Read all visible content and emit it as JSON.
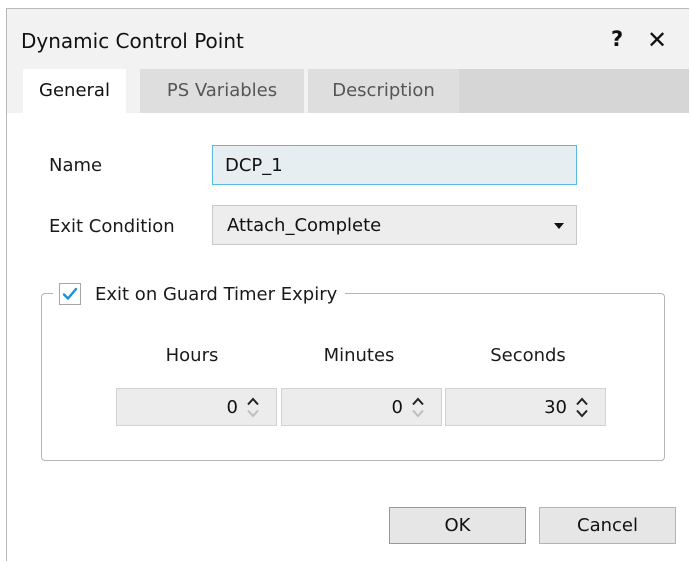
{
  "dialog": {
    "title": "Dynamic Control Point",
    "help_label": "?",
    "close_label": "✕"
  },
  "tabs": [
    {
      "label": "General",
      "active": true
    },
    {
      "label": "PS Variables",
      "active": false
    },
    {
      "label": "Description",
      "active": false
    }
  ],
  "form": {
    "name_label": "Name",
    "name_value": "DCP_1",
    "exit_condition_label": "Exit Condition",
    "exit_condition_value": "Attach_Complete"
  },
  "guard_timer": {
    "checkbox_label": "Exit on Guard Timer Expiry",
    "checked": true,
    "hours_label": "Hours",
    "minutes_label": "Minutes",
    "seconds_label": "Seconds",
    "hours_value": "0",
    "minutes_value": "0",
    "seconds_value": "30"
  },
  "buttons": {
    "ok": "OK",
    "cancel": "Cancel"
  },
  "colors": {
    "accent_border": "#5ab8e6",
    "check_color": "#1e8fd6"
  }
}
